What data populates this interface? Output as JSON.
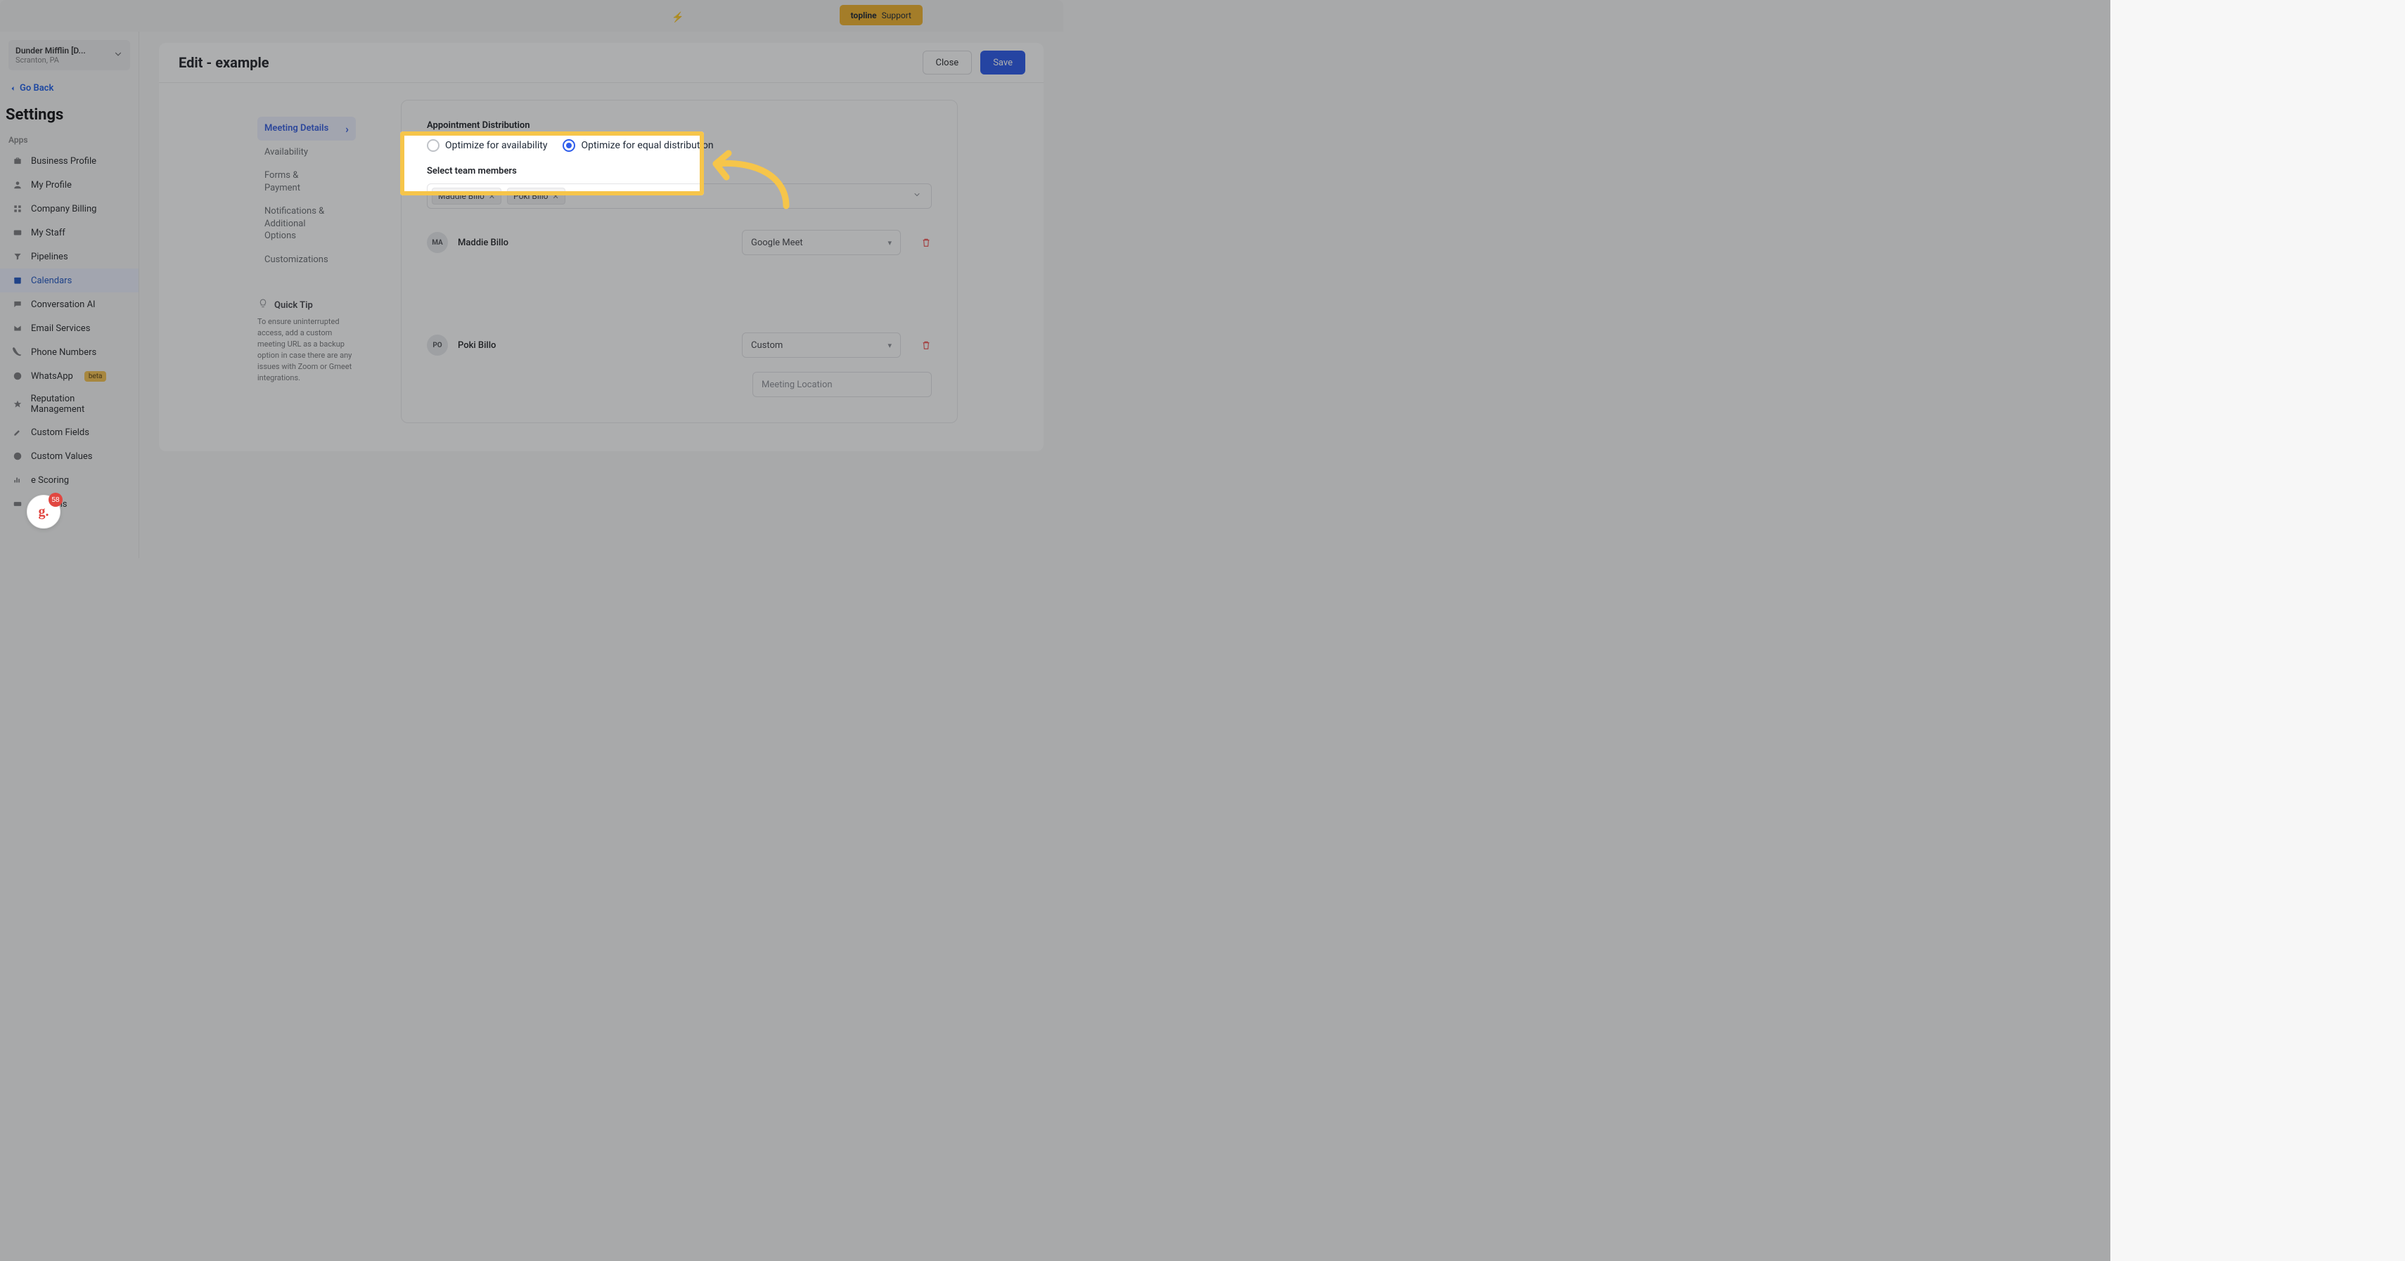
{
  "banner": {
    "support_prefix": "topline",
    "support_label": "Support"
  },
  "sidebar": {
    "account_name": "Dunder Mifflin [D...",
    "account_location": "Scranton, PA",
    "go_back": "Go Back",
    "settings_title": "Settings",
    "section_apps": "Apps",
    "items": [
      "Business Profile",
      "My Profile",
      "Company Billing",
      "My Staff",
      "Pipelines",
      "Calendars",
      "Conversation AI",
      "Email Services",
      "Phone Numbers",
      "WhatsApp",
      "Reputation Management",
      "Custom Fields",
      "Custom Values",
      "e Scoring",
      "Domains"
    ],
    "whatsapp_badge": "beta"
  },
  "main": {
    "title": "Edit - example",
    "close": "Close",
    "save": "Save"
  },
  "subnav": [
    "Meeting Details",
    "Availability",
    "Forms & Payment",
    "Notifications & Additional Options",
    "Customizations"
  ],
  "quick_tip": {
    "title": "Quick Tip",
    "body": "To ensure uninterrupted access, add a custom meeting URL as a backup option in case there are any issues with Zoom or Gmeet integrations."
  },
  "form": {
    "distribution_label": "Appointment Distribution",
    "radio_availability": "Optimize for availability",
    "radio_equal": "Optimize for equal distribution",
    "select_label": "Select team members",
    "chips": [
      "Maddie Billo",
      "Poki Billo"
    ],
    "members": [
      {
        "initials": "MA",
        "name": "Maddie Billo",
        "location": "Google Meet"
      },
      {
        "initials": "PO",
        "name": "Poki Billo",
        "location": "Custom"
      }
    ],
    "meeting_location_placeholder": "Meeting Location"
  },
  "widget": {
    "count": "58"
  }
}
